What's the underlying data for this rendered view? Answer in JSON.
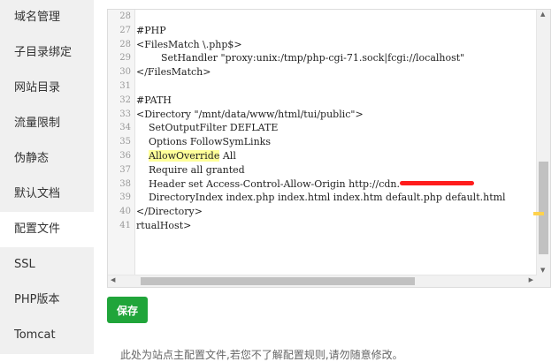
{
  "sidebar": {
    "items": [
      {
        "label": "域名管理"
      },
      {
        "label": "子目录绑定"
      },
      {
        "label": "网站目录"
      },
      {
        "label": "流量限制"
      },
      {
        "label": "伪静态"
      },
      {
        "label": "默认文档"
      },
      {
        "label": "配置文件",
        "active": true
      },
      {
        "label": "SSL"
      },
      {
        "label": "PHP版本"
      },
      {
        "label": "Tomcat"
      }
    ]
  },
  "editor": {
    "lines": [
      {
        "n": "28",
        "t": ""
      },
      {
        "n": "27",
        "t": "#PHP"
      },
      {
        "n": "28",
        "t": "<FilesMatch \\.php$>"
      },
      {
        "n": "29",
        "t": "        SetHandler \"proxy:unix:/tmp/php-cgi-71.sock|fcgi://localhost\""
      },
      {
        "n": "30",
        "t": "</FilesMatch>"
      },
      {
        "n": "31",
        "t": ""
      },
      {
        "n": "32",
        "t": "#PATH"
      },
      {
        "n": "33",
        "t": "<Directory \"/mnt/data/www/html/tui/public\">"
      },
      {
        "n": "34",
        "t": "    SetOutputFilter DEFLATE"
      },
      {
        "n": "35",
        "t": "    Options FollowSymLinks"
      },
      {
        "n": "36",
        "t": "    AllowOverride All"
      },
      {
        "n": "37",
        "t": "    Require all granted"
      },
      {
        "n": "38",
        "t": "    Header set Access-Control-Allow-Origin http://cdn."
      },
      {
        "n": "39",
        "t": "    DirectoryIndex index.php index.html index.htm default.php default.html"
      },
      {
        "n": "40",
        "t": "</Directory>"
      },
      {
        "n": "41",
        "t": "rtualHost>"
      }
    ],
    "highlight_word": "AllowOverride"
  },
  "actions": {
    "save_label": "保存"
  },
  "hint_text": "此处为站点主配置文件,若您不了解配置规则,请勿随意修改。",
  "colors": {
    "accent": "#20a53a",
    "highlight": "#ffff99",
    "redaction": "#ff1c1c"
  }
}
